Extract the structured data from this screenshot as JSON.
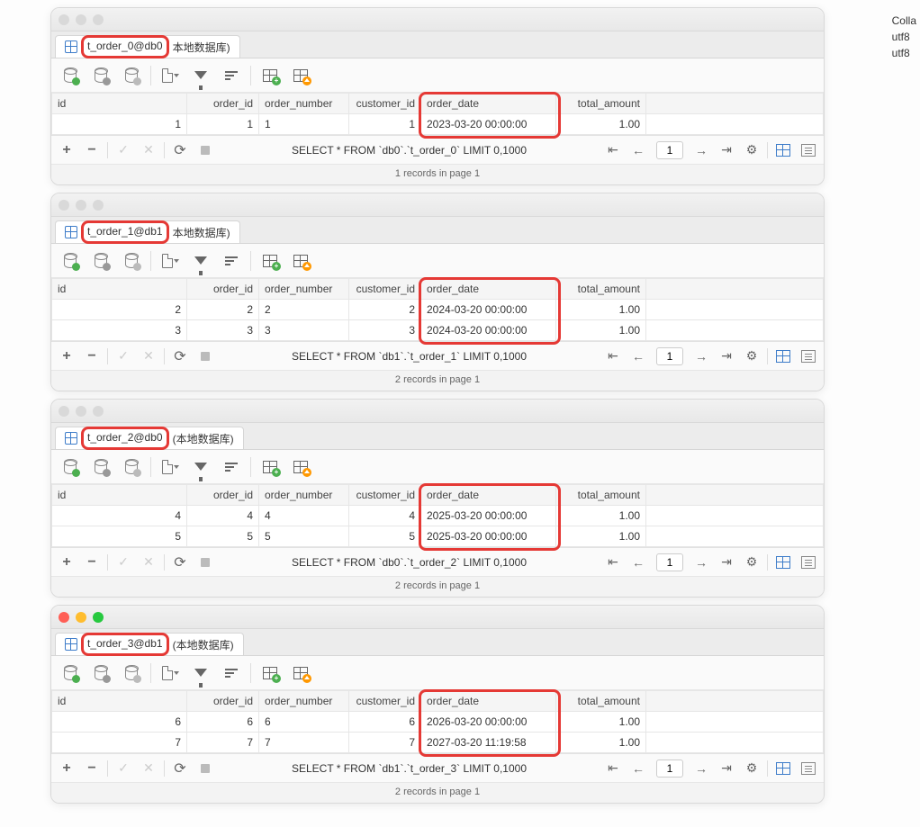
{
  "side_text": {
    "line1": "Colla",
    "line2": "utf8",
    "line3": "utf8"
  },
  "columns": [
    "id",
    "order_id",
    "order_number",
    "customer_id",
    "order_date",
    "total_amount"
  ],
  "panels": [
    {
      "traffic_active": false,
      "tab_title": "t_order_0@db0",
      "tab_suffix": "本地数据库)",
      "rows": [
        {
          "id": "1",
          "order_id": "1",
          "order_number": "1",
          "customer_id": "1",
          "order_date": "2023-03-20 00:00:00",
          "total_amount": "1.00"
        }
      ],
      "sql": "SELECT * FROM `db0`.`t_order_0` LIMIT 0,1000",
      "page": "1",
      "status": "1 records in page 1"
    },
    {
      "traffic_active": false,
      "tab_title": "t_order_1@db1",
      "tab_suffix": "本地数据库)",
      "rows": [
        {
          "id": "2",
          "order_id": "2",
          "order_number": "2",
          "customer_id": "2",
          "order_date": "2024-03-20 00:00:00",
          "total_amount": "1.00"
        },
        {
          "id": "3",
          "order_id": "3",
          "order_number": "3",
          "customer_id": "3",
          "order_date": "2024-03-20 00:00:00",
          "total_amount": "1.00"
        }
      ],
      "sql": "SELECT * FROM `db1`.`t_order_1` LIMIT 0,1000",
      "page": "1",
      "status": "2 records in page 1"
    },
    {
      "traffic_active": false,
      "tab_title": "t_order_2@db0",
      "tab_suffix": "(本地数据库)",
      "rows": [
        {
          "id": "4",
          "order_id": "4",
          "order_number": "4",
          "customer_id": "4",
          "order_date": "2025-03-20 00:00:00",
          "total_amount": "1.00"
        },
        {
          "id": "5",
          "order_id": "5",
          "order_number": "5",
          "customer_id": "5",
          "order_date": "2025-03-20 00:00:00",
          "total_amount": "1.00"
        }
      ],
      "sql": "SELECT * FROM `db0`.`t_order_2` LIMIT 0,1000",
      "page": "1",
      "status": "2 records in page 1"
    },
    {
      "traffic_active": true,
      "tab_title": "t_order_3@db1",
      "tab_suffix": "(本地数据库)",
      "rows": [
        {
          "id": "6",
          "order_id": "6",
          "order_number": "6",
          "customer_id": "6",
          "order_date": "2026-03-20 00:00:00",
          "total_amount": "1.00"
        },
        {
          "id": "7",
          "order_id": "7",
          "order_number": "7",
          "customer_id": "7",
          "order_date": "2027-03-20 11:19:58",
          "total_amount": "1.00"
        }
      ],
      "sql": "SELECT * FROM `db1`.`t_order_3` LIMIT 0,1000",
      "page": "1",
      "status": "2 records in page 1"
    }
  ]
}
